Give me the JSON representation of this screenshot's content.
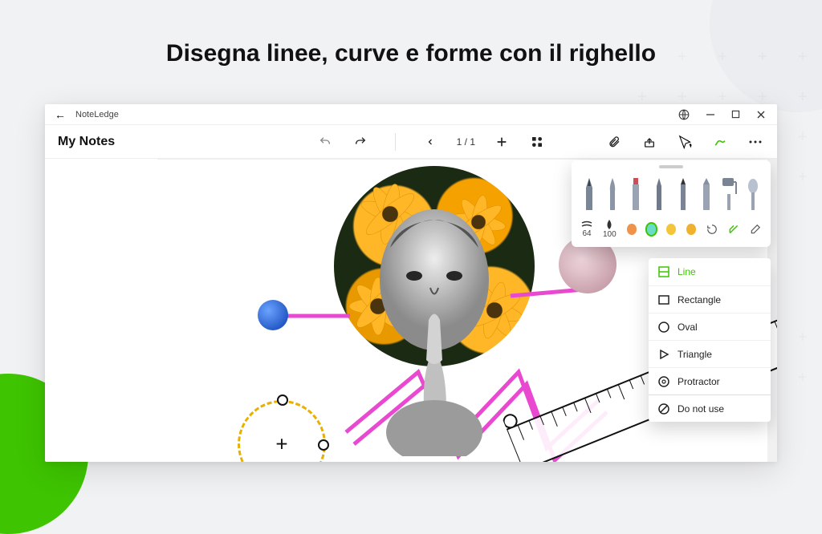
{
  "headline": "Disegna linee, curve e forme con il righello",
  "titlebar": {
    "app_name": "NoteLedge"
  },
  "toolbar": {
    "title": "My Notes",
    "page_indicator": "1 / 1"
  },
  "brush_panel": {
    "size_value": "64",
    "opacity_value": "100",
    "colors": {
      "orange": "#f0924a",
      "teal": "#6adcc6",
      "gold": "#f3c53a",
      "amber": "#f2b12c"
    }
  },
  "shape_menu": {
    "line": "Line",
    "rectangle": "Rectangle",
    "oval": "Oval",
    "triangle": "Triangle",
    "protractor": "Protractor",
    "none": "Do not use"
  }
}
